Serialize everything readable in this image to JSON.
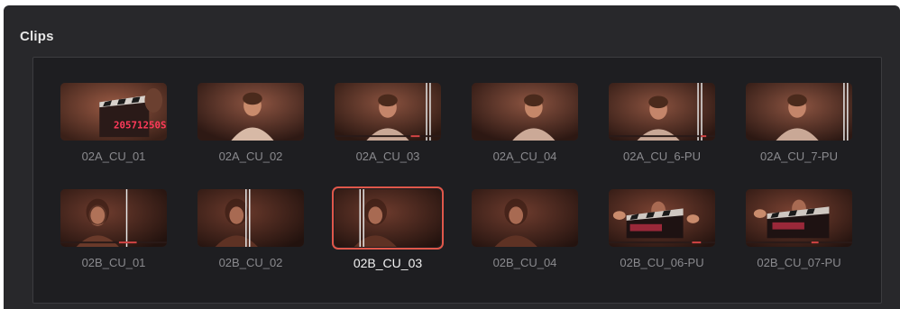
{
  "panel": {
    "title": "Clips",
    "colors": {
      "background": "#28282b",
      "frame": "#1e1e21",
      "selection": "#e0574a",
      "label": "#8a8a8e",
      "label_selected": "#f2f2f2"
    }
  },
  "clips": [
    {
      "name": "02A_CU_01",
      "selected": false,
      "slate_text": "20571250S"
    },
    {
      "name": "02A_CU_02",
      "selected": false
    },
    {
      "name": "02A_CU_03",
      "selected": false
    },
    {
      "name": "02A_CU_04",
      "selected": false
    },
    {
      "name": "02A_CU_6-PU",
      "selected": false
    },
    {
      "name": "02A_CU_7-PU",
      "selected": false
    },
    {
      "name": "02B_CU_01",
      "selected": false
    },
    {
      "name": "02B_CU_02",
      "selected": false
    },
    {
      "name": "02B_CU_03",
      "selected": true
    },
    {
      "name": "02B_CU_04",
      "selected": false
    },
    {
      "name": "02B_CU_06-PU",
      "selected": false
    },
    {
      "name": "02B_CU_07-PU",
      "selected": false
    }
  ]
}
